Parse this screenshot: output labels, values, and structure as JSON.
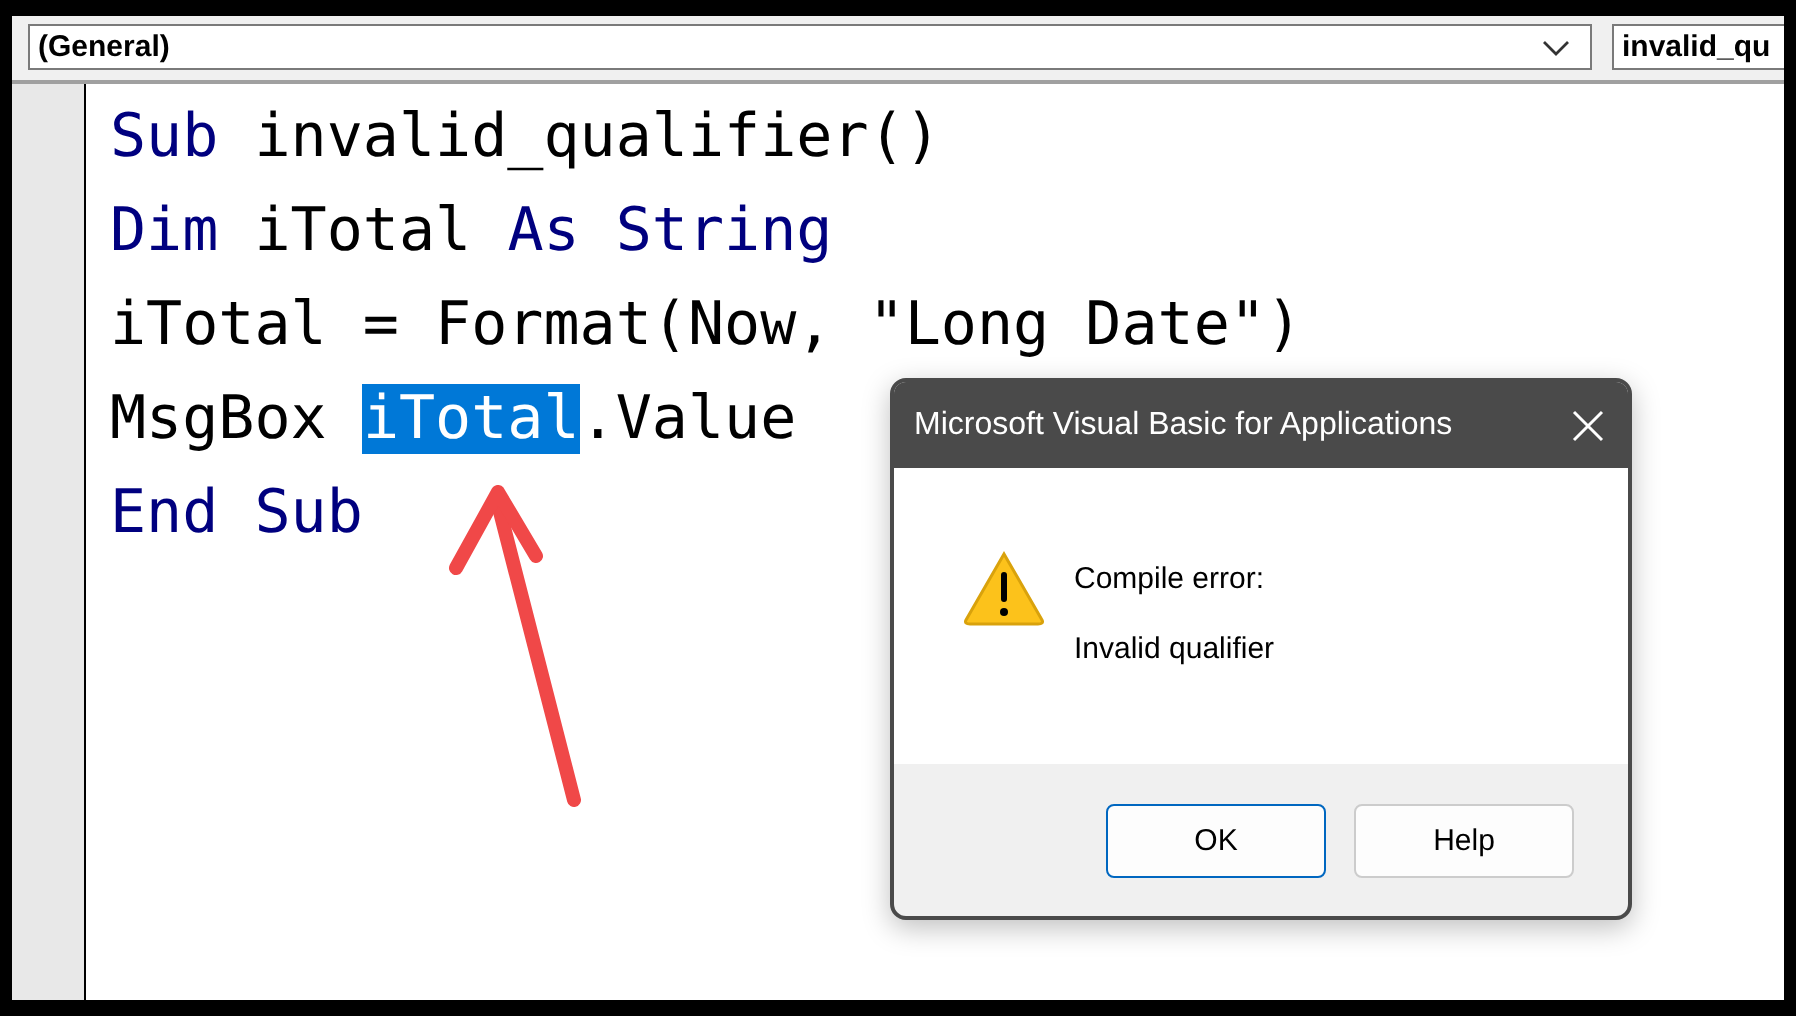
{
  "toolbar": {
    "object_combo": {
      "value": "(General)"
    },
    "procedure_combo": {
      "value": "invalid_qu"
    }
  },
  "code_lines": [
    {
      "tokens": [
        {
          "text": "Sub",
          "kind": "keyword"
        },
        {
          "text": " invalid_qualifier()",
          "kind": "plain"
        }
      ]
    },
    {
      "tokens": [
        {
          "text": "Dim",
          "kind": "keyword"
        },
        {
          "text": " iTotal ",
          "kind": "plain"
        },
        {
          "text": "As ",
          "kind": "keyword"
        },
        {
          "text": "String",
          "kind": "keyword"
        }
      ]
    },
    {
      "tokens": [
        {
          "text": "iTotal = Format(Now, \"Long Date\")",
          "kind": "plain"
        }
      ]
    },
    {
      "tokens": [
        {
          "text": "MsgBox ",
          "kind": "plain"
        },
        {
          "text": "iTotal",
          "kind": "selected"
        },
        {
          "text": ".Value",
          "kind": "plain"
        }
      ]
    },
    {
      "tokens": [
        {
          "text": "End Sub",
          "kind": "keyword"
        }
      ]
    }
  ],
  "dialog": {
    "title": "Microsoft Visual Basic for Applications",
    "heading": "Compile error:",
    "message": "Invalid qualifier",
    "buttons": [
      {
        "label": "OK",
        "selected": true
      },
      {
        "label": "Help",
        "selected": false
      }
    ]
  }
}
